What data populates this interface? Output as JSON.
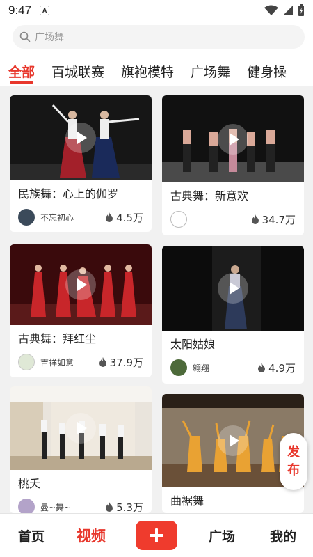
{
  "status": {
    "time": "9:47",
    "notification_icon": "A"
  },
  "search": {
    "placeholder": "广场舞"
  },
  "tabs": [
    {
      "label": "全部",
      "active": true
    },
    {
      "label": "百城联赛"
    },
    {
      "label": "旗袍模特"
    },
    {
      "label": "广场舞"
    },
    {
      "label": "健身操"
    }
  ],
  "videos": [
    {
      "title": "民族舞：心上的伽罗",
      "author": "不忘初心",
      "views": "4.5万"
    },
    {
      "title": "古典舞：新意欢",
      "author": "",
      "views": "34.7万"
    },
    {
      "title": "古典舞：拜红尘",
      "author": "吉祥如意",
      "views": "37.9万"
    },
    {
      "title": "太阳姑娘",
      "author": "翱翔",
      "views": "4.9万"
    },
    {
      "title": "桃夭",
      "author": "曼~舞~",
      "views": "5.3万"
    },
    {
      "title": "曲裾舞",
      "author": "",
      "views": ""
    }
  ],
  "publish": {
    "line1": "发",
    "line2": "布"
  },
  "nav": {
    "home": "首页",
    "video": "视频",
    "square": "广场",
    "mine": "我的"
  },
  "colors": {
    "accent": "#e8372c",
    "background": "#f1f1f1"
  }
}
